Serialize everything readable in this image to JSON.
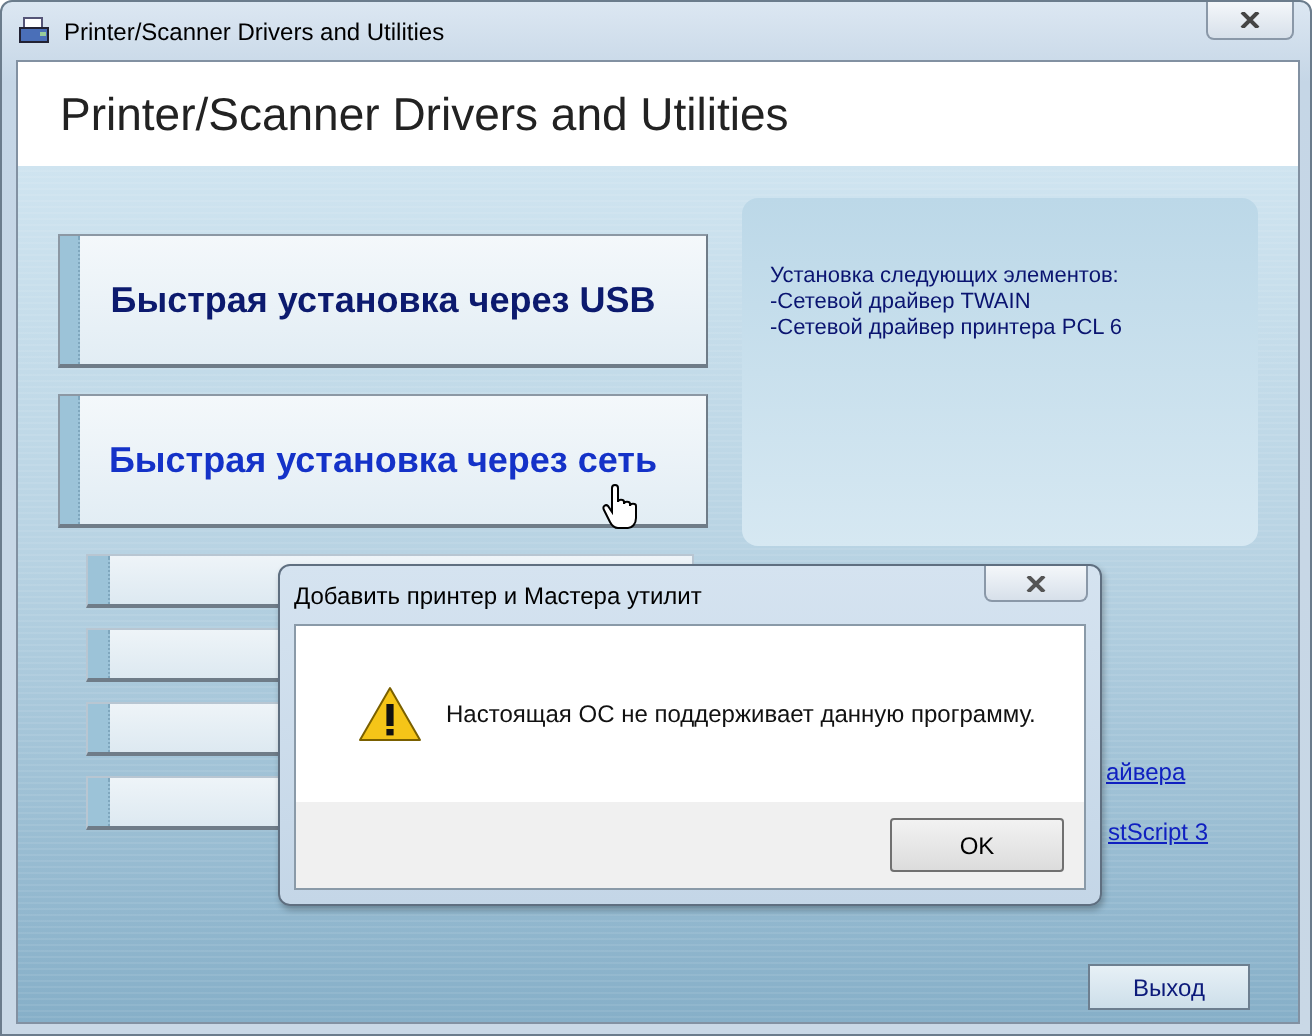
{
  "window": {
    "title": "Printer/Scanner Drivers and Utilities"
  },
  "header": {
    "title": "Printer/Scanner Drivers and Utilities"
  },
  "install_buttons": [
    {
      "label": "Быстрая установка через USB",
      "hovered": false
    },
    {
      "label": "Быстрая установка через сеть",
      "hovered": true
    }
  ],
  "other_buttons": [
    {
      "kind": "blank"
    },
    {
      "kind": "blank"
    },
    {
      "kind": "blank"
    },
    {
      "kind": "blank"
    }
  ],
  "info_panel": {
    "lines": [
      "Установка следующих элементов:",
      "-Сетевой драйвер TWAIN",
      "-Сетевой драйвер принтера PCL 6"
    ]
  },
  "links": [
    "айвера",
    "stScript 3"
  ],
  "exit_button": "Выход",
  "dialog": {
    "title": "Добавить принтер и Мастера утилит",
    "message": "Настоящая ОС не поддерживает данную программу.",
    "ok_button": "OK"
  }
}
